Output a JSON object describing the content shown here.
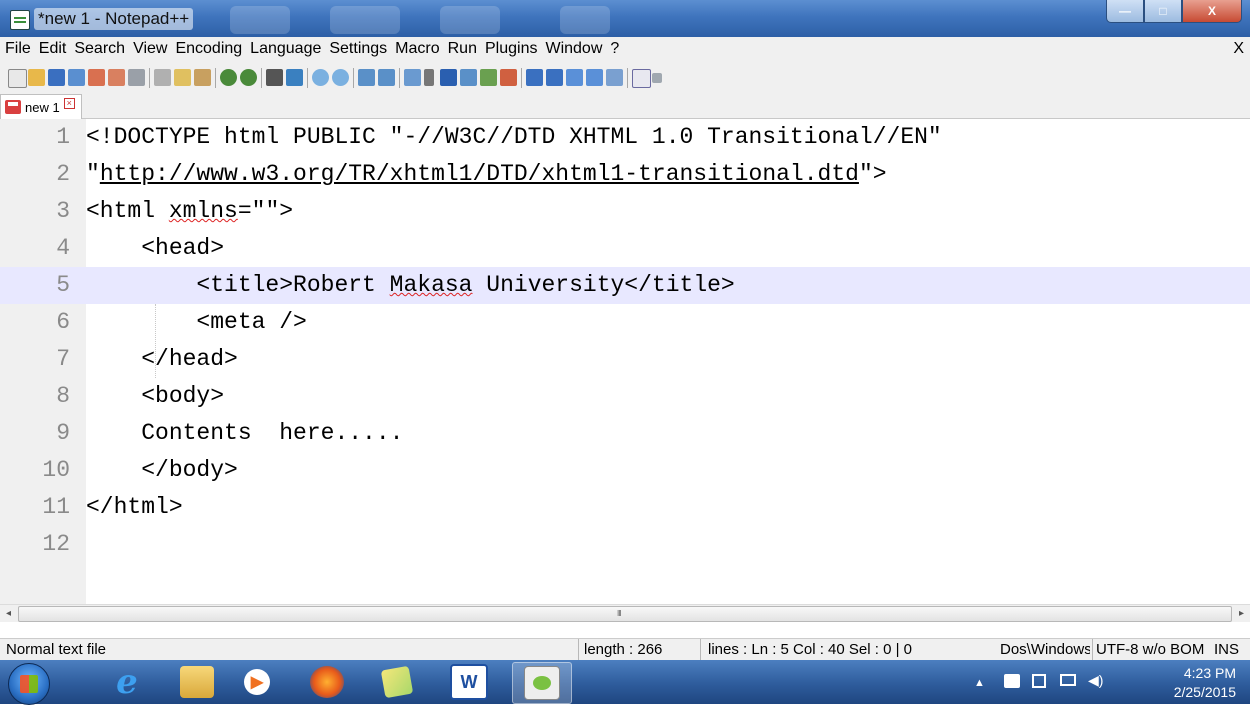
{
  "window": {
    "title": "*new  1 - Notepad++",
    "buttons": {
      "minimize": "—",
      "maximize": "□",
      "close": "X"
    }
  },
  "menubar": {
    "items": [
      "File",
      "Edit",
      "Search",
      "View",
      "Encoding",
      "Language",
      "Settings",
      "Macro",
      "Run",
      "Plugins",
      "Window",
      "?"
    ],
    "close_label": "X"
  },
  "toolbar": {
    "icons": [
      "new-file-icon",
      "open-file-icon",
      "save-icon",
      "save-all-icon",
      "close-icon",
      "close-all-icon",
      "print-icon",
      "cut-icon",
      "copy-icon",
      "paste-icon",
      "undo-icon",
      "redo-icon",
      "find-icon",
      "replace-icon",
      "zoom-in-icon",
      "zoom-out-icon",
      "sync-vertical-icon",
      "sync-horizontal-icon",
      "word-wrap-icon",
      "show-all-chars-icon",
      "indent-guide-icon",
      "document-map-icon",
      "function-list-icon",
      "folder-workspace-icon",
      "record-macro-icon",
      "stop-record-icon",
      "play-macro-icon",
      "run-macro-multiple-icon",
      "save-macro-icon",
      "spell-check-icon",
      "spell-options-icon"
    ]
  },
  "tabs": [
    {
      "label": "new 1",
      "close": "×"
    }
  ],
  "editor": {
    "current_line": 5,
    "lines": [
      {
        "num": "1",
        "text": "<!DOCTYPE html PUBLIC \"-//W3C//DTD XHTML 1.0 Transitional//EN\""
      },
      {
        "num": "2",
        "pre": "\"",
        "url": "http://www.w3.org/TR/xhtml1/DTD/xhtml1-transitional.dtd",
        "post": "\">"
      },
      {
        "num": "3",
        "pre": "<html ",
        "squiggle": "xmlns",
        "post": "=\"\">"
      },
      {
        "num": "4",
        "text": "    <head>"
      },
      {
        "num": "5",
        "pre": "        <title>Robert ",
        "squiggle": "Makasa",
        "post": " University</title>"
      },
      {
        "num": "6",
        "text": "        <meta />"
      },
      {
        "num": "7",
        "text": "    </head>"
      },
      {
        "num": "8",
        "text": "    <body>"
      },
      {
        "num": "9",
        "text": "    Contents  here....."
      },
      {
        "num": "10",
        "text": "    </body>"
      },
      {
        "num": "11",
        "text": "</html>"
      },
      {
        "num": "12",
        "text": ""
      }
    ]
  },
  "scrollbar": {
    "grip": "III",
    "left": "◂",
    "right": "▸"
  },
  "statusbar": {
    "file_type": "Normal text file",
    "length": "length : 266",
    "position": "lines : Ln : 5    Col : 40    Sel : 0 | 0",
    "eol": "Dos\\Windows",
    "encoding": "UTF-8 w/o BOM",
    "mode": "INS"
  },
  "taskbar": {
    "apps": [
      "internet-explorer",
      "file-explorer",
      "media-player",
      "firefox",
      "sticky-notes",
      "word",
      "notepad-plus-plus"
    ],
    "clock_time": "4:23 PM",
    "clock_date": "2/25/2015",
    "tray_icons": [
      "show-hidden-icon",
      "action-center-icon",
      "network-icon",
      "display-icon",
      "volume-icon"
    ],
    "colors": {
      "taskbar": "#2e5c9c",
      "accent": "#3f74bd"
    }
  }
}
